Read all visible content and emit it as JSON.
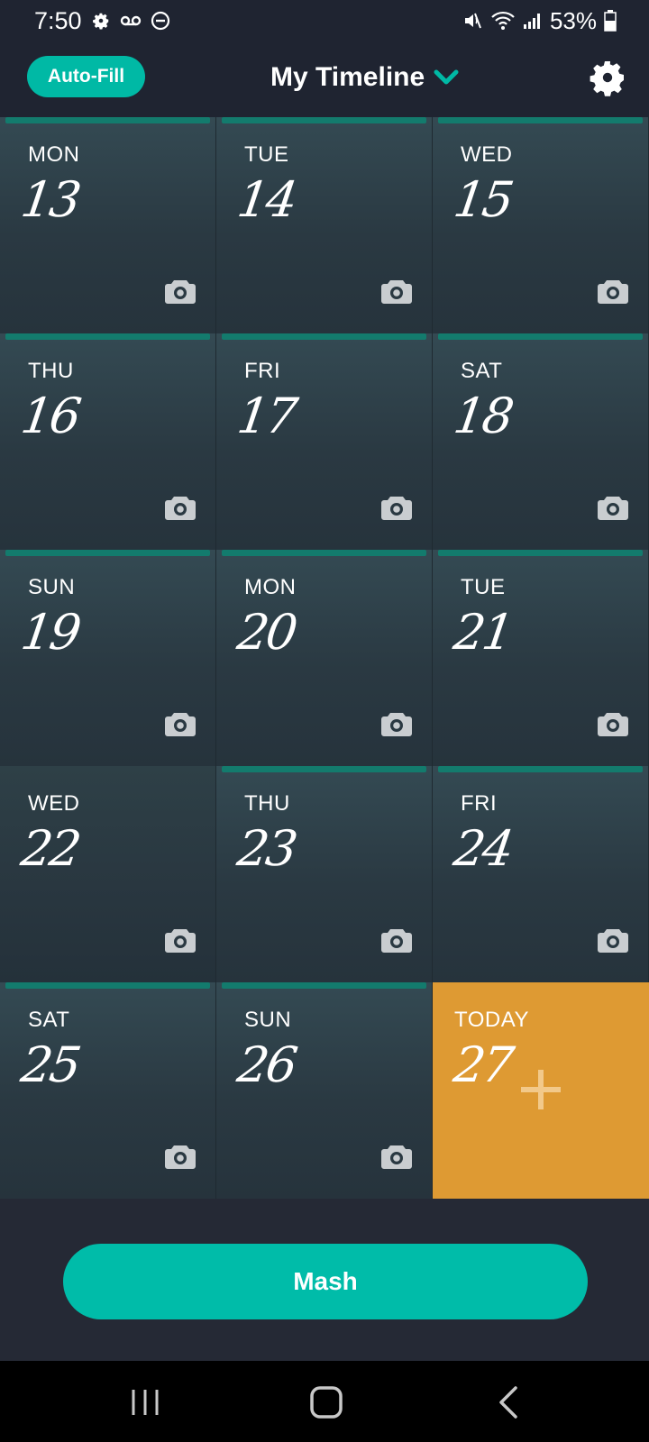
{
  "status_bar": {
    "time": "7:50",
    "battery": "53%",
    "left_icons": [
      "gear-icon",
      "voicemail-icon",
      "do-not-disturb-icon"
    ],
    "right_icons": [
      "mute-icon",
      "wifi-icon",
      "signal-icon",
      "battery-icon"
    ]
  },
  "header": {
    "autofill_label": "Auto-Fill",
    "title": "My Timeline",
    "title_icon": "chevron-down-icon",
    "settings_icon": "gear-icon"
  },
  "colors": {
    "accent": "#00b9a5",
    "bar": "#137b6d",
    "today": "#de9a33",
    "background": "#252935"
  },
  "days": [
    {
      "day": "MON",
      "date": "13",
      "has_bar": true
    },
    {
      "day": "TUE",
      "date": "14",
      "has_bar": true
    },
    {
      "day": "WED",
      "date": "15",
      "has_bar": true
    },
    {
      "day": "THU",
      "date": "16",
      "has_bar": true
    },
    {
      "day": "FRI",
      "date": "17",
      "has_bar": true
    },
    {
      "day": "SAT",
      "date": "18",
      "has_bar": true
    },
    {
      "day": "SUN",
      "date": "19",
      "has_bar": true
    },
    {
      "day": "MON",
      "date": "20",
      "has_bar": true
    },
    {
      "day": "TUE",
      "date": "21",
      "has_bar": true
    },
    {
      "day": "WED",
      "date": "22",
      "has_bar": false
    },
    {
      "day": "THU",
      "date": "23",
      "has_bar": true
    },
    {
      "day": "FRI",
      "date": "24",
      "has_bar": true
    },
    {
      "day": "SAT",
      "date": "25",
      "has_bar": true
    },
    {
      "day": "SUN",
      "date": "26",
      "has_bar": true
    },
    {
      "day": "TODAY",
      "date": "27",
      "has_bar": false,
      "today": true
    }
  ],
  "mash_label": "Mash",
  "nav": [
    "recents-icon",
    "home-icon",
    "back-icon"
  ]
}
